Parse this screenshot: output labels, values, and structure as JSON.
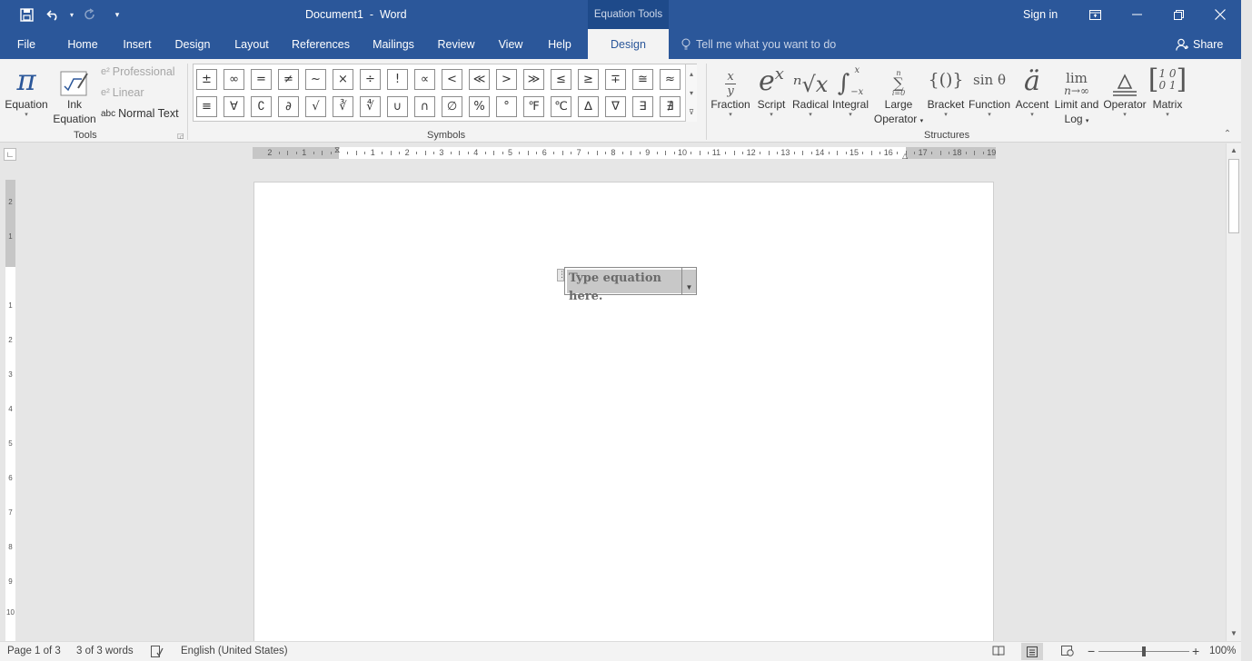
{
  "titlebar": {
    "doc_name": "Document1  -  Word",
    "context_header": "Equation Tools",
    "sign_in": "Sign in"
  },
  "tabs": [
    {
      "label": "File",
      "name": "tab-file"
    },
    {
      "label": "Home",
      "name": "tab-home"
    },
    {
      "label": "Insert",
      "name": "tab-insert"
    },
    {
      "label": "Design",
      "name": "tab-design"
    },
    {
      "label": "Layout",
      "name": "tab-layout"
    },
    {
      "label": "References",
      "name": "tab-references"
    },
    {
      "label": "Mailings",
      "name": "tab-mailings"
    },
    {
      "label": "Review",
      "name": "tab-review"
    },
    {
      "label": "View",
      "name": "tab-view"
    },
    {
      "label": "Help",
      "name": "tab-help"
    },
    {
      "label": "Design",
      "name": "tab-equation-design",
      "active": true
    }
  ],
  "tell_me": "Tell me what you want to do",
  "share": "Share",
  "ribbon": {
    "tools": {
      "group_label": "Tools",
      "equation": "Equation",
      "ink_line1": "Ink",
      "ink_line2": "Equation",
      "professional": "Professional",
      "linear": "Linear",
      "normal_text": "Normal Text",
      "normal_text_prefix": "abc"
    },
    "symbols": {
      "group_label": "Symbols",
      "row1": [
        "±",
        "∞",
        "=",
        "≠",
        "~",
        "×",
        "÷",
        "!",
        "∝",
        "<",
        "≪",
        ">",
        "≫",
        "≤",
        "≥",
        "∓",
        "≅",
        "≈"
      ],
      "row2": [
        "≡",
        "∀",
        "∁",
        "∂",
        "√",
        "∛",
        "∜",
        "∪",
        "∩",
        "∅",
        "%",
        "°",
        "℉",
        "℃",
        "∆",
        "∇",
        "∃",
        "∄"
      ]
    },
    "structures": {
      "group_label": "Structures",
      "fraction": "Fraction",
      "script": "Script",
      "radical": "Radical",
      "integral": "Integral",
      "large_line1": "Large",
      "large_line2": "Operator",
      "bracket": "Bracket",
      "function": "Function",
      "accent": "Accent",
      "limit_line1": "Limit and",
      "limit_line2": "Log",
      "operator": "Operator",
      "matrix": "Matrix",
      "icons": {
        "fraction_num": "x",
        "fraction_den": "y",
        "script_base": "e",
        "script_sup": "x",
        "radical": "ⁿ√x",
        "integral": "∫",
        "integral_upper": "x",
        "integral_lower": "−x",
        "sum": "∑",
        "sum_upper": "n",
        "sum_lower": "i=0",
        "bracket": "{()}",
        "function": "sin θ",
        "accent": "ä",
        "limit_top": "lim",
        "limit_bottom": "n→∞",
        "operator": "≜",
        "matrix": "[1 0; 0 1]",
        "matrix_row1": "1 0",
        "matrix_row2": "0 1"
      }
    }
  },
  "ruler": {
    "left_labels": [
      "2",
      "1"
    ],
    "labels": [
      "1",
      "2",
      "3",
      "4",
      "5",
      "6",
      "7",
      "8",
      "9",
      "10",
      "11",
      "12",
      "13",
      "14",
      "15",
      "16",
      "17",
      "18",
      "19"
    ],
    "vertical_labels": [
      "2",
      "1",
      "1",
      "2",
      "3",
      "4",
      "5",
      "6",
      "7",
      "8",
      "9",
      "10"
    ]
  },
  "document": {
    "equation_placeholder": "Type equation here."
  },
  "statusbar": {
    "page": "Page 1 of 3",
    "words": "3 of 3 words",
    "language": "English (United States)",
    "zoom": "100%"
  }
}
